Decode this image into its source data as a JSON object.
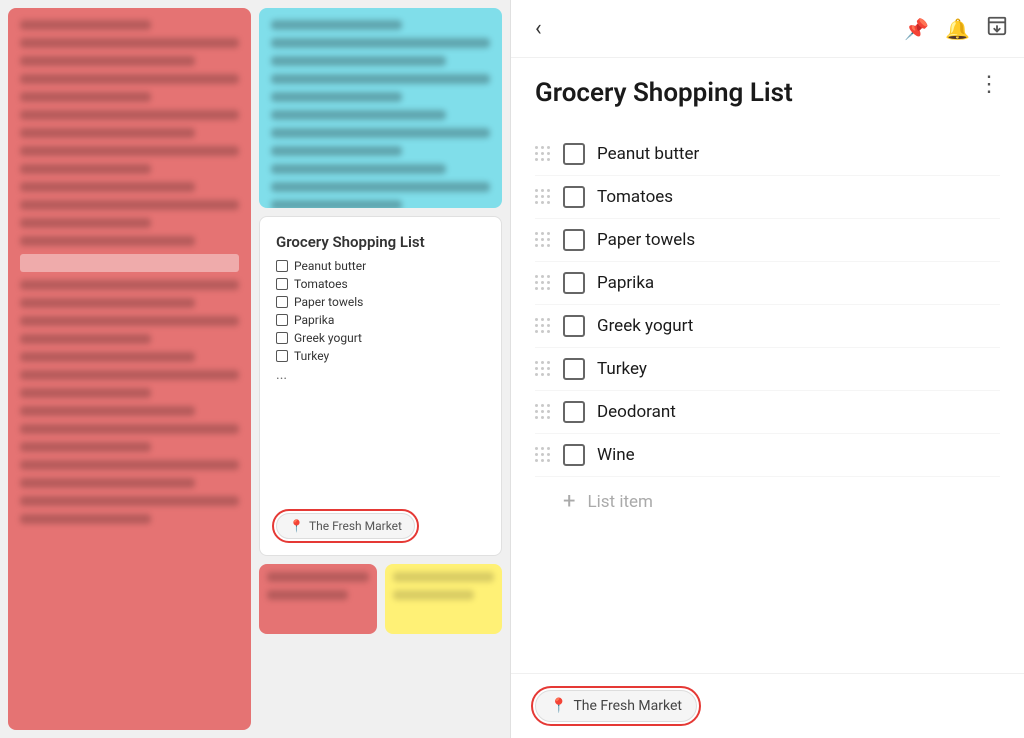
{
  "left_panel": {
    "mini_note": {
      "title": "Grocery Shopping List",
      "items": [
        "Peanut butter",
        "Tomatoes",
        "Paper towels",
        "Paprika",
        "Greek yogurt",
        "Turkey"
      ],
      "ellipsis": "...",
      "location_label": "The Fresh Market"
    }
  },
  "right_panel": {
    "back_label": "‹",
    "icons": {
      "pin": "🖈",
      "reminder": "🔔",
      "archive": "⬇"
    },
    "title": "Grocery Shopping List",
    "menu_dots": "⋮",
    "items": [
      "Peanut butter",
      "Tomatoes",
      "Paper towels",
      "Paprika",
      "Greek yogurt",
      "Turkey",
      "Deodorant",
      "Wine"
    ],
    "add_item_placeholder": "List item",
    "location_label": "The Fresh Market"
  }
}
